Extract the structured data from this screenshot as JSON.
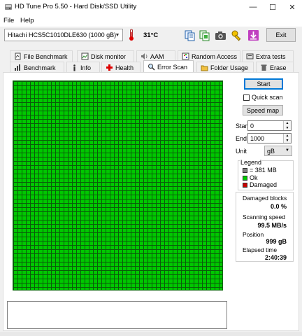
{
  "window": {
    "title": "HD Tune Pro 5.50 - Hard Disk/SSD Utility",
    "minimize": "—",
    "maximize": "☐",
    "close": "✕"
  },
  "menu": {
    "file": "File",
    "help": "Help"
  },
  "toolbar": {
    "drive": "Hitachi HCS5C1010DLE630 (1000 gB)",
    "temperature": "31°C",
    "exit_label": "Exit"
  },
  "tabs_top": [
    {
      "label": "File Benchmark",
      "icon": "file-benchmark-icon"
    },
    {
      "label": "Disk monitor",
      "icon": "disk-monitor-icon"
    },
    {
      "label": "AAM",
      "icon": "speaker-icon"
    },
    {
      "label": "Random Access",
      "icon": "random-access-icon"
    },
    {
      "label": "Extra tests",
      "icon": "extra-tests-icon"
    }
  ],
  "tabs_bottom": [
    {
      "label": "Benchmark",
      "icon": "benchmark-icon"
    },
    {
      "label": "Info",
      "icon": "info-icon"
    },
    {
      "label": "Health",
      "icon": "health-cross-icon"
    },
    {
      "label": "Error Scan",
      "icon": "magnifier-icon",
      "active": true
    },
    {
      "label": "Folder Usage",
      "icon": "folder-icon"
    },
    {
      "label": "Erase",
      "icon": "trash-icon"
    }
  ],
  "scan": {
    "start_button": "Start",
    "quick_scan_label": "Quick scan",
    "quick_scan_checked": false,
    "speed_map_button": "Speed map",
    "start_label": "Start",
    "start_value": "0",
    "end_label": "End",
    "end_value": "1000",
    "unit_label": "Unit",
    "unit_value": "gB"
  },
  "legend": {
    "title": "Legend",
    "block_size": "= 381 MB",
    "ok": "Ok",
    "damaged": "Damaged",
    "colors": {
      "ok": "#00c800",
      "damaged": "#c80000",
      "block": "#808080"
    }
  },
  "stats": {
    "damaged_blocks_label": "Damaged blocks",
    "damaged_blocks_value": "0.0 %",
    "scanning_speed_label": "Scanning speed",
    "scanning_speed_value": "99.5 MB/s",
    "position_label": "Position",
    "position_value": "999 gB",
    "elapsed_time_label": "Elapsed time",
    "elapsed_time_value": "2:40:39"
  }
}
